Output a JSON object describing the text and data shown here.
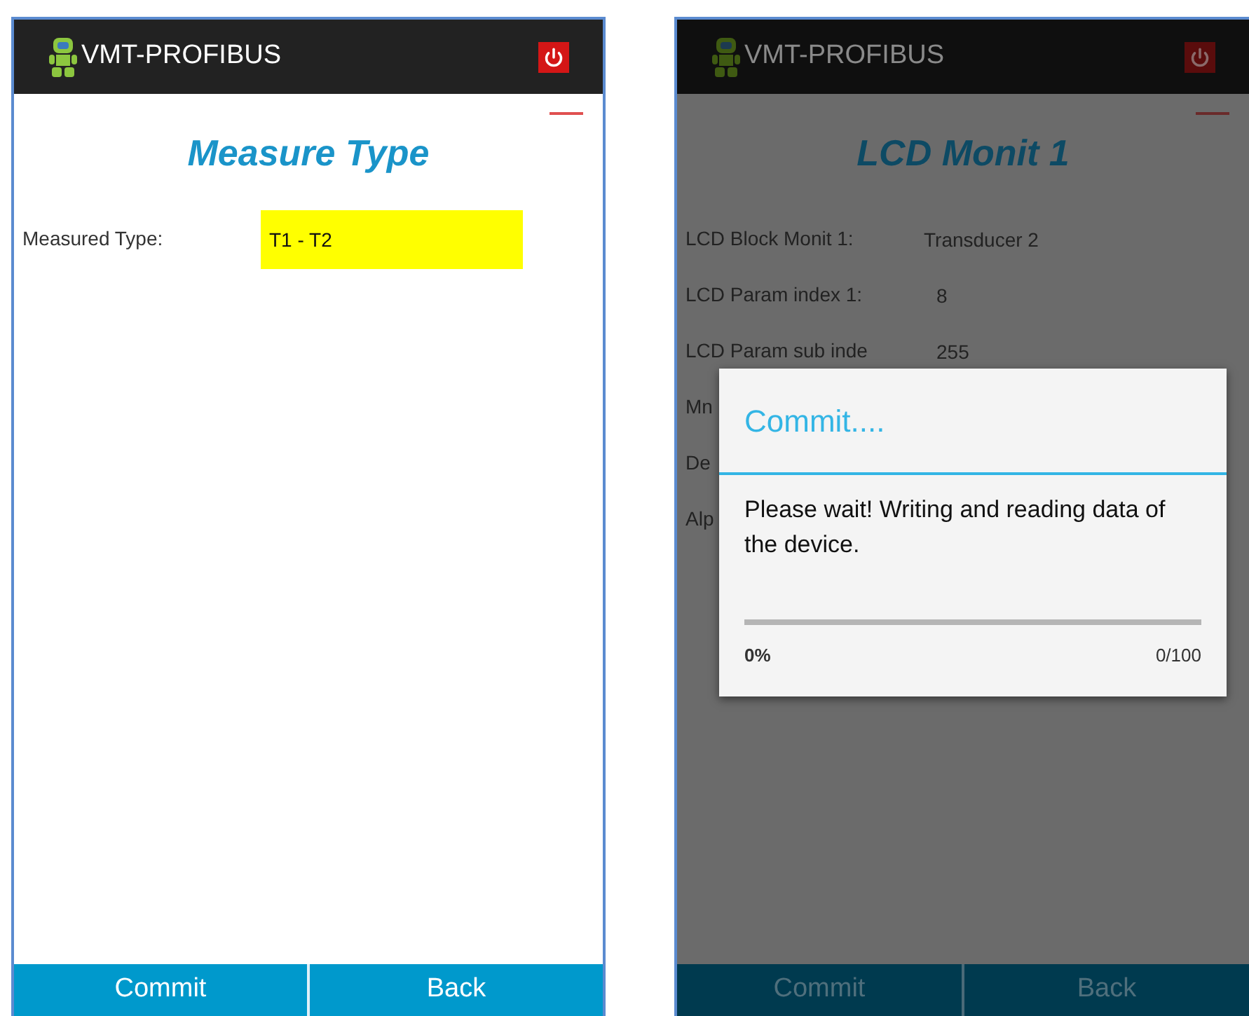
{
  "screens": [
    {
      "app_title": "VMT-PROFIBUS",
      "dimmed": false,
      "title": "Measure Type",
      "fields": [
        {
          "label": "Measured Type:",
          "value": "T1 - T2",
          "kind": "field"
        }
      ],
      "buttons": [
        "Commit",
        "Back"
      ]
    },
    {
      "app_title": "VMT-PROFIBUS",
      "dimmed": true,
      "title": "LCD Monit 1",
      "fields": [
        {
          "label": "LCD Block Monit 1:",
          "value": "Transducer 2",
          "kind": "text"
        },
        {
          "label": "LCD Param index 1:",
          "value": "8",
          "kind": "text"
        },
        {
          "label": "LCD Param sub inde",
          "value": "255",
          "kind": "text"
        },
        {
          "label": "Mn"
        },
        {
          "label": "De"
        },
        {
          "label": "Alp"
        }
      ],
      "buttons": [
        "Commit",
        "Back"
      ],
      "dialog": {
        "title": "Commit....",
        "message": "Please wait! Writing and reading data of the device.",
        "level": 0,
        "percent": "0%",
        "count": "0/100"
      }
    }
  ]
}
